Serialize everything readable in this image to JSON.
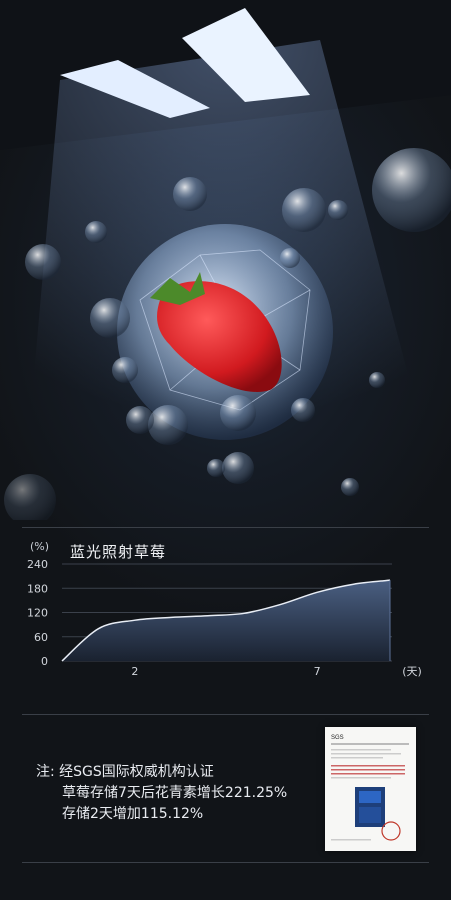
{
  "chart_data": {
    "type": "area",
    "title": "蓝光照射草莓",
    "ylabel": "(%)",
    "xlabel": "(天)",
    "ylim": [
      0,
      240
    ],
    "yticks": [
      "240",
      "180",
      "120",
      "60",
      "0"
    ],
    "xticks": [
      "2",
      "7"
    ],
    "grid": true,
    "x": [
      0,
      1,
      2,
      3,
      4,
      5,
      6,
      7,
      8,
      9
    ],
    "values": [
      0,
      80,
      101,
      108,
      112,
      118,
      140,
      170,
      190,
      200
    ]
  },
  "note": {
    "prefix": "注:",
    "line1": "经SGS国际权威机构认证",
    "line2": "草莓存储7天后花青素增长221.25%",
    "line3": "存储2天增加115.12%"
  },
  "document": {
    "brand": "SGS",
    "heading": "SGS检测·技术报告",
    "stamp_color": "#c0392b"
  },
  "colors": {
    "area_top": "#4a5f82",
    "area_bottom": "#1a2230",
    "line": "#e8edf5"
  }
}
